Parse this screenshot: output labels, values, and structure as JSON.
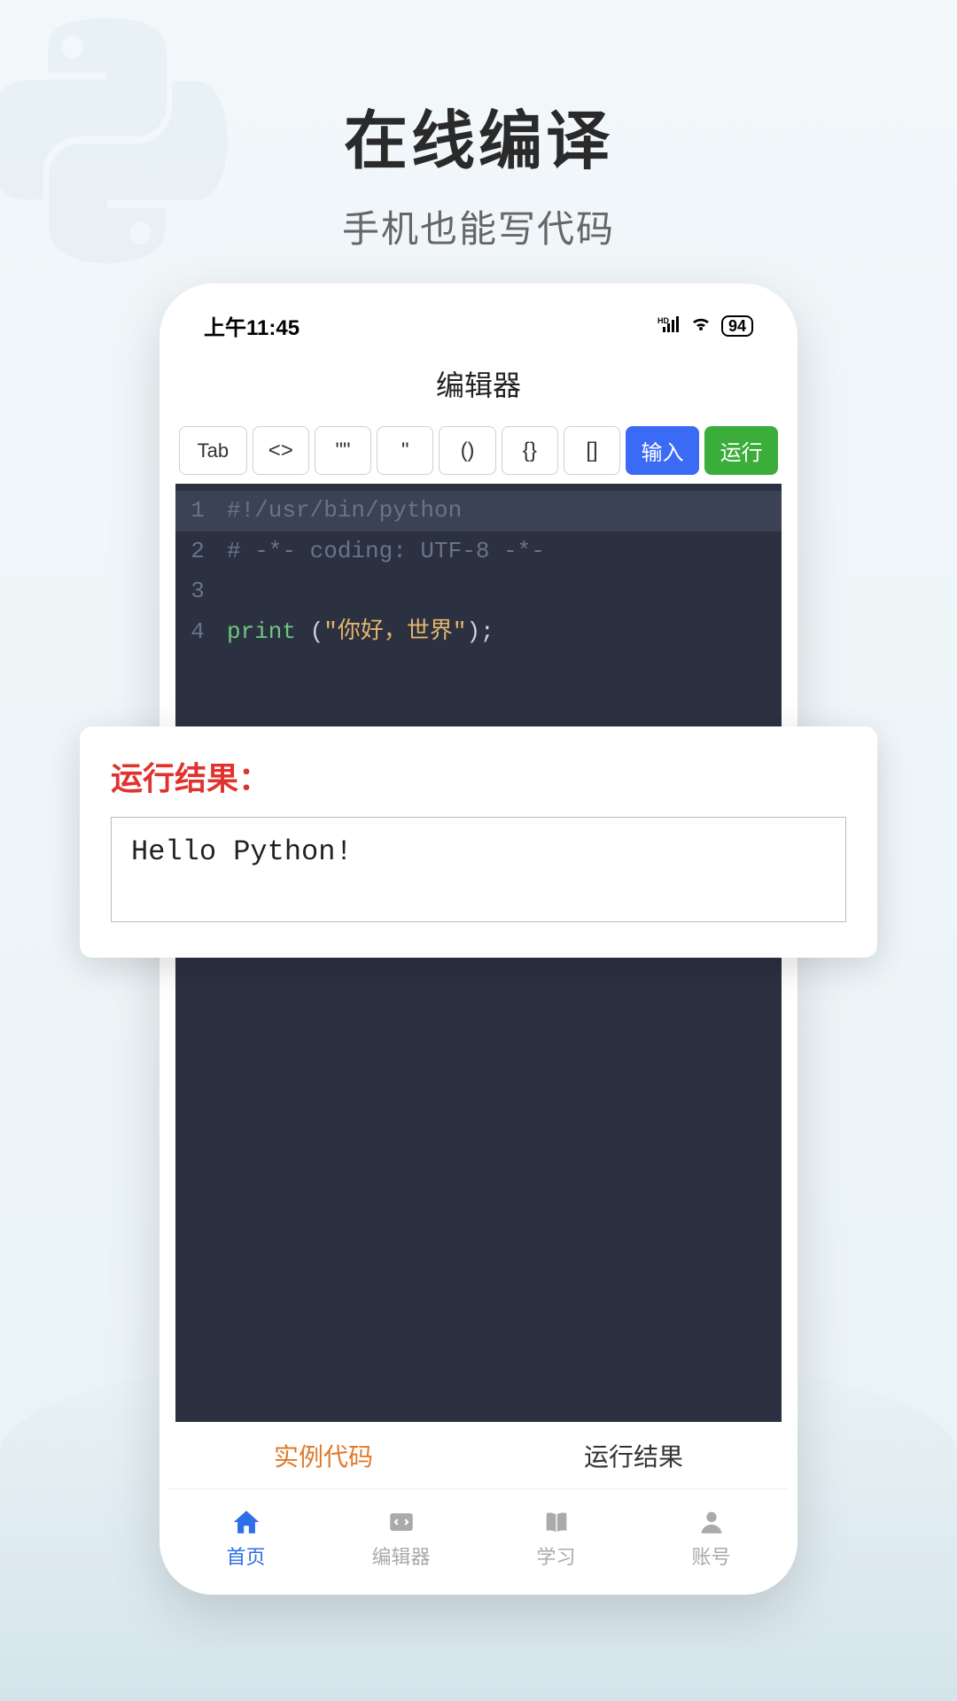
{
  "hero": {
    "title": "在线编译",
    "subtitle": "手机也能写代码"
  },
  "statusBar": {
    "time": "上午11:45",
    "battery": "94"
  },
  "app": {
    "headerTitle": "编辑器"
  },
  "toolbar": {
    "tab": "Tab",
    "angle": "<>",
    "dquote": "\"\"",
    "squote": "\"",
    "paren": "()",
    "brace": "{}",
    "bracket": "[]",
    "input": "输入",
    "run": "运行"
  },
  "code": {
    "line1_num": "1",
    "line1_text": "#!/usr/bin/python",
    "line2_num": "2",
    "line2_text": "# -*- coding: UTF-8 -*-",
    "line3_num": "3",
    "line4_num": "4",
    "line4_kw": "print ",
    "line4_paren_open": "(",
    "line4_str": "\"你好，世界\"",
    "line4_paren_close": ");"
  },
  "tabs": {
    "exampleCode": "实例代码",
    "runResult": "运行结果"
  },
  "bottomNav": {
    "home": "首页",
    "editor": "编辑器",
    "study": "学习",
    "account": "账号"
  },
  "resultPanel": {
    "title": "运行结果：",
    "output": "Hello Python!"
  }
}
